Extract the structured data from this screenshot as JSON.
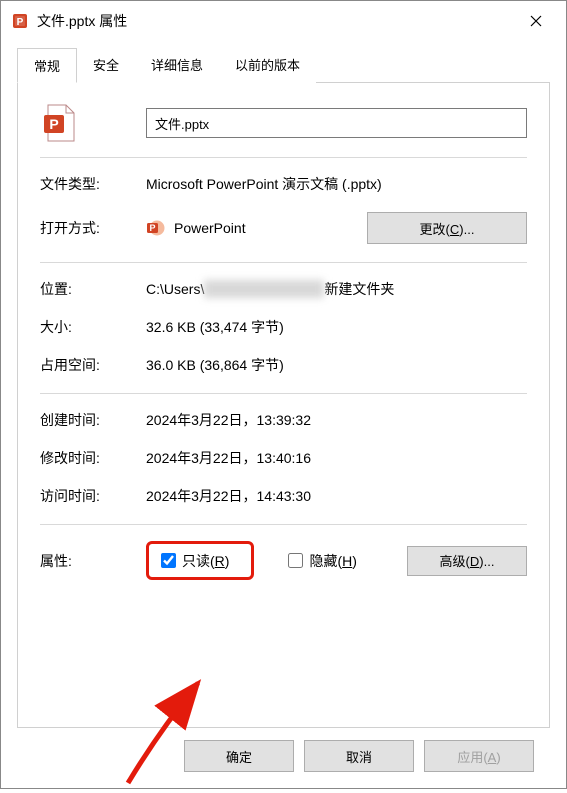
{
  "window": {
    "title": "文件.pptx 属性"
  },
  "tabs": {
    "general": "常规",
    "security": "安全",
    "details": "详细信息",
    "previous": "以前的版本"
  },
  "file": {
    "name": "文件.pptx"
  },
  "labels": {
    "filetype": "文件类型:",
    "opens_with": "打开方式:",
    "location": "位置:",
    "size": "大小:",
    "disk_size": "占用空间:",
    "created": "创建时间:",
    "modified": "修改时间:",
    "accessed": "访问时间:",
    "attributes": "属性:"
  },
  "values": {
    "filetype": "Microsoft PowerPoint 演示文稿 (.pptx)",
    "opens_with": "PowerPoint",
    "location_prefix": "C:\\Users\\",
    "location_suffix": "新建文件夹",
    "size": "32.6 KB (33,474 字节)",
    "disk_size": "36.0 KB (36,864 字节)",
    "created": "2024年3月22日，13:39:32",
    "modified": "2024年3月22日，13:40:16",
    "accessed": "2024年3月22日，14:43:30"
  },
  "attributes": {
    "readonly_label": "只读(",
    "readonly_shortcut": "R",
    "readonly_suffix": ")",
    "hidden_label": "隐藏(",
    "hidden_shortcut": "H",
    "hidden_suffix": ")"
  },
  "buttons": {
    "change": "更改(",
    "change_shortcut": "C",
    "change_suffix": ")...",
    "advanced": "高级(",
    "advanced_shortcut": "D",
    "advanced_suffix": ")...",
    "ok": "确定",
    "cancel": "取消",
    "apply": "应用(",
    "apply_shortcut": "A",
    "apply_suffix": ")"
  }
}
